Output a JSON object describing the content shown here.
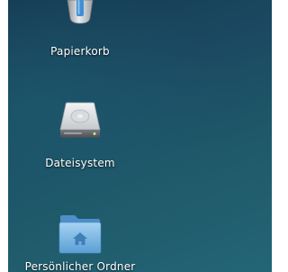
{
  "desktop": {
    "background_colors": [
      "#153a52",
      "#236576"
    ],
    "icons": [
      {
        "label": "Papierkorb",
        "icon": "trash-icon"
      },
      {
        "label": "Dateisystem",
        "icon": "drive-icon"
      },
      {
        "label": "Persönlicher Ordner",
        "icon": "home-folder-icon"
      }
    ]
  }
}
